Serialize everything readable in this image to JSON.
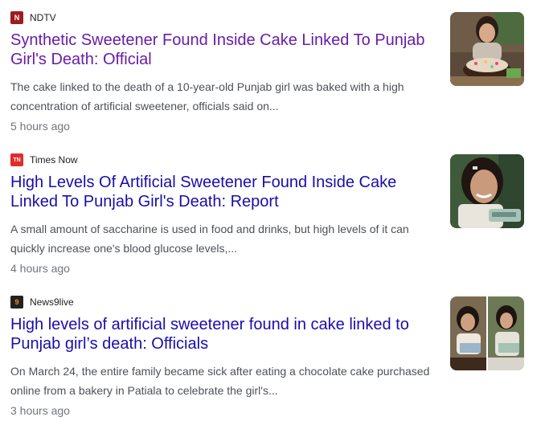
{
  "colors": {
    "visited_link": "#681da8",
    "link": "#1a0dab"
  },
  "articles": [
    {
      "source": "NDTV",
      "logo_text": "N",
      "logo_color": "#9e1b1f",
      "headline": "Synthetic Sweetener Found Inside Cake Linked To Punjab Girl's Death: Official",
      "visited": true,
      "snippet": "The cake linked to the death of a 10-year-old Punjab girl was baked with a high concentration of artificial sweetener, officials said on...",
      "time": "5 hours ago",
      "thumbnail": "girl-with-birthday-cake-photo"
    },
    {
      "source": "Times Now",
      "logo_text": "TN",
      "logo_color": "#e32b2b",
      "headline": "High Levels Of Artificial Sweetener Found Inside Cake Linked To Punjab Girl's Death: Report",
      "visited": false,
      "snippet": "A small amount of saccharine is used in food and drinks, but high levels of it can quickly increase one's blood glucose levels,...",
      "time": "4 hours ago",
      "thumbnail": "smiling-girl-photo"
    },
    {
      "source": "News9live",
      "logo_text": "9",
      "logo_color": "#f28c18",
      "headline": "High levels of artificial sweetener found in cake linked to Punjab girl’s death: Officials",
      "visited": false,
      "snippet": "On March 24, the entire family became sick after eating a chocolate cake purchased online from a bakery in Patiala to celebrate the girl's...",
      "time": "3 hours ago",
      "thumbnail": "girl-collage-photo"
    }
  ]
}
